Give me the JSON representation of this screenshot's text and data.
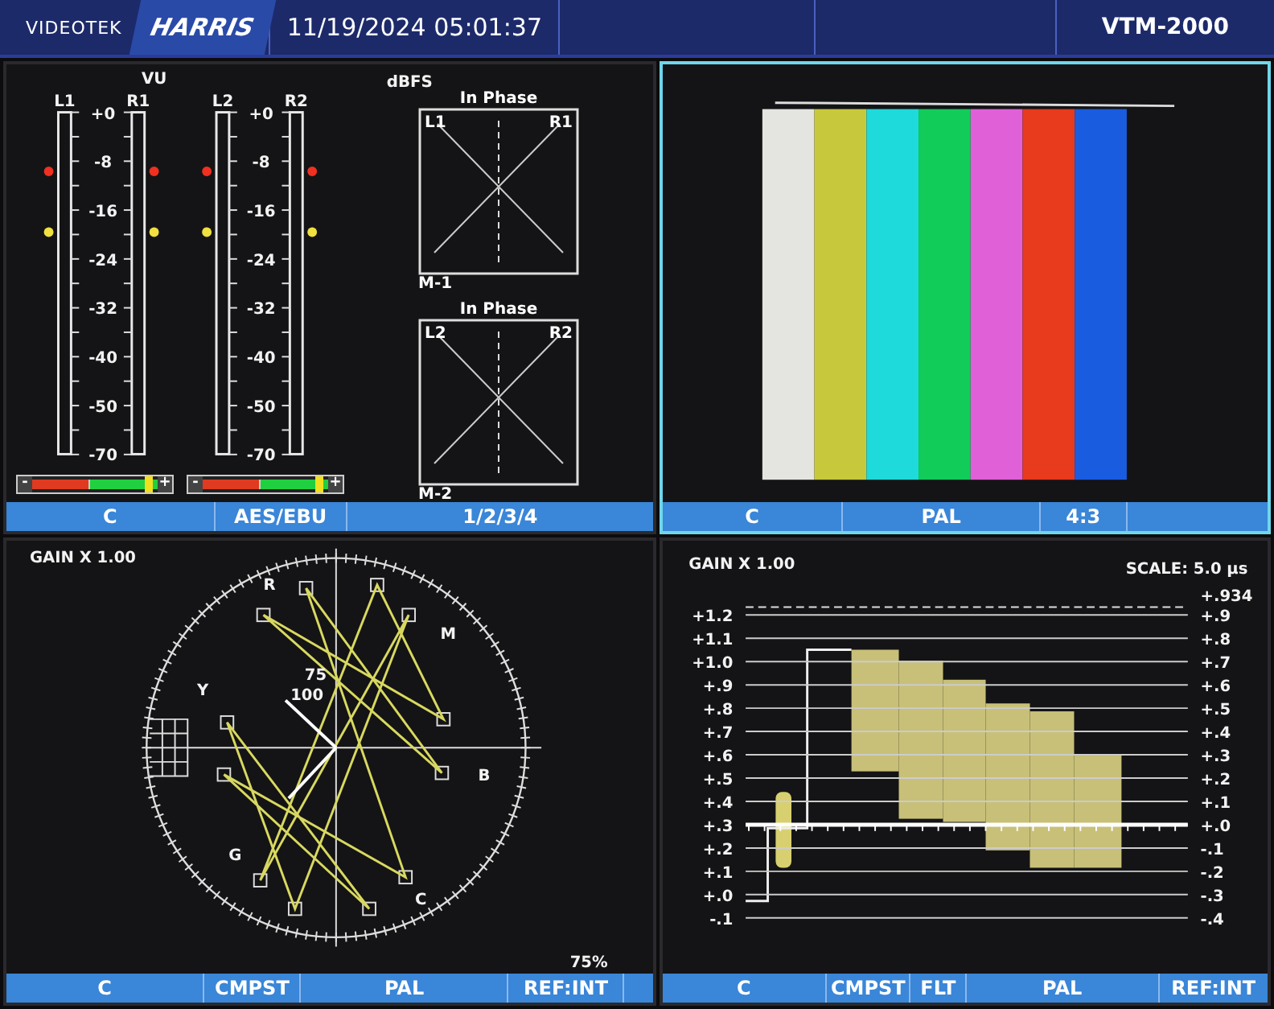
{
  "header": {
    "brand": "VIDEOTEK",
    "logo": "HARRIS",
    "datetime": "11/19/2024 05:01:37",
    "model": "VTM-2000"
  },
  "panels": [
    {
      "kind": "audio",
      "selected": false,
      "vu_title": "VU",
      "dbfs_title": "dBFS",
      "meter_pairs": [
        {
          "left": "L1",
          "right": "R1",
          "scale": [
            "+0",
            "-8",
            "-16",
            "-24",
            "-32",
            "-40",
            "-50",
            "-70"
          ],
          "balance": {
            "minus": "-",
            "plus": "+",
            "level": 0.93
          }
        },
        {
          "left": "L2",
          "right": "R2",
          "scale": [
            "+0",
            "-8",
            "-16",
            "-24",
            "-32",
            "-40",
            "-50",
            "-70"
          ],
          "balance": {
            "minus": "-",
            "plus": "+",
            "level": 0.93
          }
        }
      ],
      "phase_scopes": [
        {
          "title": "In Phase",
          "left": "L1",
          "right": "R1",
          "label": "M-1"
        },
        {
          "title": "In Phase",
          "left": "L2",
          "right": "R2",
          "label": "M-2"
        }
      ],
      "status_bar": [
        "C",
        "AES/EBU",
        "1/2/3/4"
      ]
    },
    {
      "kind": "picture",
      "selected": true,
      "bars": [
        {
          "color": "#e4e4e0"
        },
        {
          "color": "#c8c83c"
        },
        {
          "color": "#1edada"
        },
        {
          "color": "#12cc5a"
        },
        {
          "color": "#e060d8"
        },
        {
          "color": "#e83a1c"
        },
        {
          "color": "#1a5ce0"
        }
      ],
      "status_bar": [
        "C",
        "PAL",
        "4:3"
      ]
    },
    {
      "kind": "vectorscope",
      "selected": false,
      "gain": "GAIN X 1.00",
      "targets": [
        "R",
        "M",
        "Y",
        "B",
        "G",
        "C"
      ],
      "ring_labels": [
        "75",
        "100"
      ],
      "percent": "75%",
      "status_bar": [
        "C",
        "CMPST",
        "PAL",
        "REF:INT"
      ]
    },
    {
      "kind": "waveform",
      "selected": false,
      "gain": "GAIN X 1.00",
      "scale": "SCALE: 5.0 µs",
      "left_ticks": [
        "+1.2",
        "+1.1",
        "+1.0",
        "+.9",
        "+.8",
        "+.7",
        "+.6",
        "+.5",
        "+.4",
        "+.3",
        "+.2",
        "+.1",
        "+.0",
        "-.1"
      ],
      "right_top": "+.934",
      "right_ticks": [
        "+.9",
        "+.8",
        "+.7",
        "+.6",
        "+.5",
        "+.4",
        "+.3",
        "+.2",
        "+.1",
        "+.0",
        "-.1",
        "-.2",
        "-.3",
        "-.4"
      ],
      "status_bar": [
        "C",
        "CMPST",
        "FLT",
        "PAL",
        "REF:INT"
      ]
    }
  ]
}
